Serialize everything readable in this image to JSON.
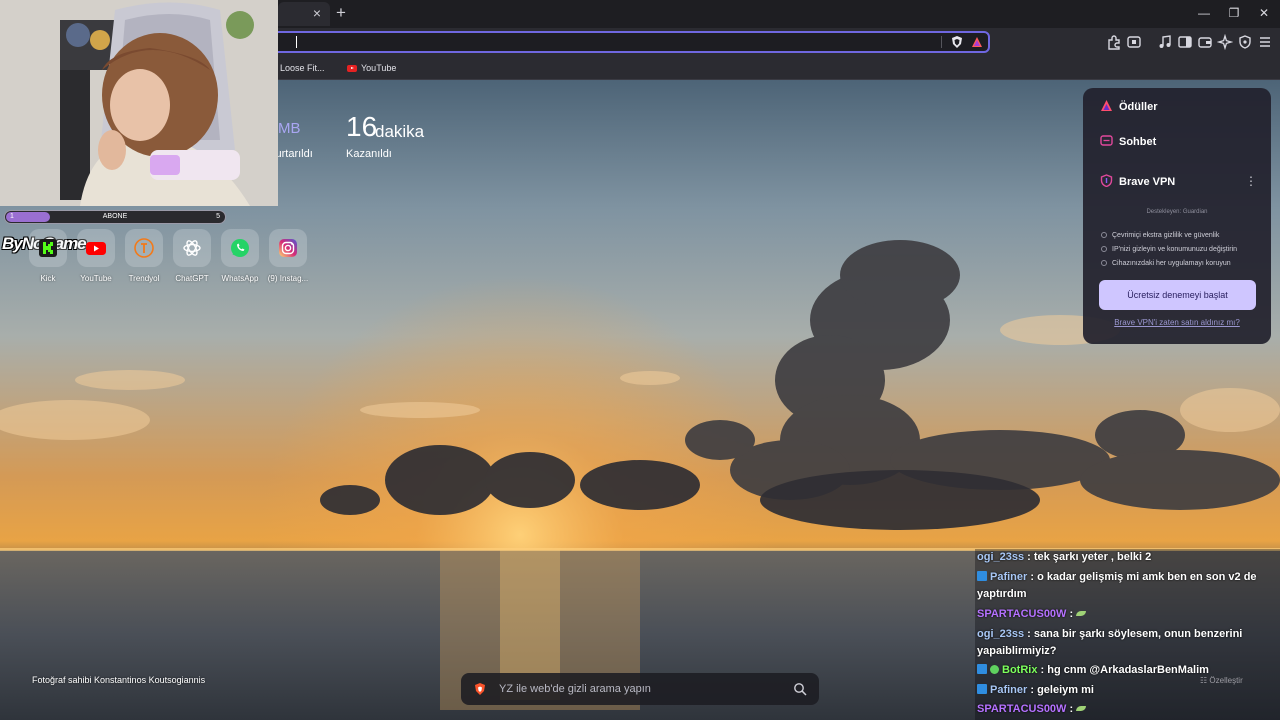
{
  "browser": {
    "tab_close": "×",
    "new_tab": "+",
    "window_controls": [
      "—",
      "❐",
      "✕"
    ],
    "bookmarks": [
      {
        "label": "tshirt Loose Fit...",
        "icon": "none"
      },
      {
        "label": "YouTube",
        "icon": "youtube-icon"
      }
    ]
  },
  "stats": {
    "data_saved_unit": "MB",
    "data_saved_label": "kurtarıldı",
    "time_saved_value": "16",
    "time_saved_unit": "dakika",
    "time_saved_label": "Kazanıldı"
  },
  "stream": {
    "subgoal": {
      "current": "1",
      "label": "ABONE",
      "target": "5",
      "progress": 0.2
    },
    "logo": "ByNoGame"
  },
  "top_sites": [
    {
      "label": "Kick",
      "icon": "kick-icon"
    },
    {
      "label": "YouTube",
      "icon": "youtube-icon"
    },
    {
      "label": "Trendyol",
      "icon": "trendyol-icon"
    },
    {
      "label": "ChatGPT",
      "icon": "chatgpt-icon"
    },
    {
      "label": "WhatsApp",
      "icon": "whatsapp-icon"
    },
    {
      "label": "(9) Instag...",
      "icon": "instagram-icon"
    }
  ],
  "panel": {
    "rewards": "Ödüller",
    "chat": "Sohbet",
    "vpn_title": "Brave VPN",
    "more": "⋮",
    "sponsor": "Destekleyen:  Guardian",
    "bullets": [
      "Çevrimiçi ekstra gizlilik ve güvenlik",
      "IP'nizi gizleyin ve konumunuzu değiştirin",
      "Cihazınızdaki her uygulamayı koruyun"
    ],
    "cta": "Ücretsiz denemeyi başlat",
    "link": "Brave VPN'i zaten satın aldınız mı?"
  },
  "footer": {
    "credit": "Fotoğraf sahibi Konstantinos Koutsogiannis",
    "search_placeholder": "YZ ile web'de gizli arama yapın",
    "customize": "Özelleştir"
  },
  "chat": [
    {
      "user": "ogi_23ss",
      "text": ": tek şarkı yeter , belki 2",
      "color": "blue",
      "badge": "none"
    },
    {
      "user": "Pafiner",
      "text": ": o kadar gelişmiş mi amk ben en son v2 de yaptırdım",
      "color": "blue",
      "badge": "sub"
    },
    {
      "user": "SPARTACUS00W",
      "text": ":",
      "color": "purple",
      "badge": "none",
      "emote": "leaf"
    },
    {
      "user": "ogi_23ss",
      "text": ": sana bir şarkı söylesem, onun benzerini yapaiblirmiyiz?",
      "color": "blue",
      "badge": "none"
    },
    {
      "user": "BotRix",
      "text": ": hg cnm @ArkadaslarBenMalim",
      "color": "green",
      "badge": "bot"
    },
    {
      "user": "Pafiner",
      "text": ": geleiym mi",
      "color": "blue",
      "badge": "sub"
    },
    {
      "user": "SPARTACUS00W",
      "text": ":",
      "color": "purple",
      "badge": "none",
      "emote": "leaf"
    }
  ],
  "colors": {
    "accent": "#6f67e0",
    "cta_bg": "#cfc6ff",
    "chat_user_blue": "#a8c7f5",
    "chat_user_purple": "#b571ff",
    "chat_user_green": "#7cff5c"
  }
}
